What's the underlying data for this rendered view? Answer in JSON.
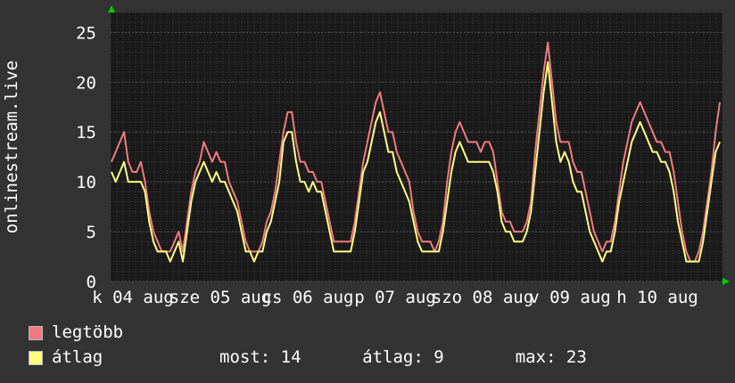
{
  "chart_data": {
    "type": "line",
    "ylabel": "onlinestream.live",
    "ylim": [
      0,
      27
    ],
    "yticks": [
      0,
      5,
      10,
      15,
      20,
      25
    ],
    "x_tick_labels": [
      "k 04 aug",
      "sze 05 aug",
      "cs 06 aug",
      "p 07 aug",
      "szo 08 aug",
      "v 09 aug",
      "h 10 aug"
    ],
    "grid": true,
    "series": [
      {
        "name": "legtöbb",
        "color": "#f07a80",
        "values": [
          12,
          13,
          14,
          15,
          12,
          11,
          11,
          12,
          10,
          7,
          5,
          4,
          3,
          3,
          3,
          4,
          5,
          3,
          6,
          9,
          11,
          12,
          14,
          13,
          12,
          13,
          12,
          12,
          10,
          9,
          8,
          6,
          4,
          3,
          3,
          3,
          4,
          6,
          7,
          9,
          12,
          15,
          17,
          17,
          14,
          12,
          12,
          11,
          11,
          10,
          10,
          8,
          6,
          4,
          4,
          4,
          4,
          4,
          6,
          9,
          12,
          14,
          16,
          18,
          19,
          17,
          15,
          15,
          13,
          12,
          11,
          10,
          7,
          5,
          4,
          4,
          4,
          3,
          4,
          6,
          10,
          13,
          15,
          16,
          15,
          14,
          14,
          14,
          13,
          14,
          14,
          13,
          10,
          7,
          6,
          6,
          5,
          5,
          5,
          6,
          8,
          13,
          17,
          21,
          24,
          20,
          16,
          14,
          14,
          14,
          12,
          11,
          11,
          9,
          7,
          5,
          4,
          3,
          4,
          4,
          6,
          9,
          12,
          14,
          16,
          17,
          18,
          17,
          16,
          15,
          14,
          14,
          13,
          13,
          11,
          8,
          5,
          3,
          2,
          2,
          3,
          5,
          8,
          11,
          15,
          18
        ]
      },
      {
        "name": "átlag",
        "color": "#ffff80",
        "values": [
          11,
          10,
          11,
          12,
          10,
          10,
          10,
          10,
          9,
          6,
          4,
          3,
          3,
          3,
          2,
          3,
          4,
          2,
          5,
          8,
          10,
          11,
          12,
          11,
          10,
          11,
          10,
          10,
          9,
          8,
          7,
          5,
          3,
          3,
          2,
          3,
          3,
          5,
          6,
          8,
          10,
          14,
          15,
          15,
          12,
          10,
          10,
          9,
          10,
          9,
          9,
          7,
          5,
          3,
          3,
          3,
          3,
          3,
          5,
          8,
          11,
          12,
          14,
          16,
          17,
          15,
          13,
          13,
          11,
          10,
          9,
          8,
          6,
          4,
          3,
          3,
          3,
          3,
          3,
          5,
          8,
          11,
          13,
          14,
          13,
          12,
          12,
          12,
          12,
          12,
          12,
          11,
          9,
          6,
          5,
          5,
          4,
          4,
          4,
          5,
          7,
          11,
          15,
          19,
          22,
          18,
          14,
          12,
          13,
          12,
          10,
          9,
          9,
          7,
          5,
          4,
          3,
          2,
          3,
          3,
          5,
          8,
          10,
          12,
          14,
          15,
          16,
          15,
          14,
          13,
          13,
          12,
          12,
          11,
          9,
          6,
          4,
          2,
          2,
          2,
          2,
          4,
          7,
          10,
          13,
          14
        ]
      }
    ]
  },
  "legend": {
    "max_label": "legtöbb",
    "avg_label": "átlag",
    "stats": "most: 14      átlag: 9       max: 23"
  },
  "colors": {
    "background": "#333333",
    "plot": "#1a1a1a",
    "grid": "#444444",
    "max": "#f07a80",
    "avg": "#ffff80",
    "axis_arrow": "#00cc00"
  }
}
